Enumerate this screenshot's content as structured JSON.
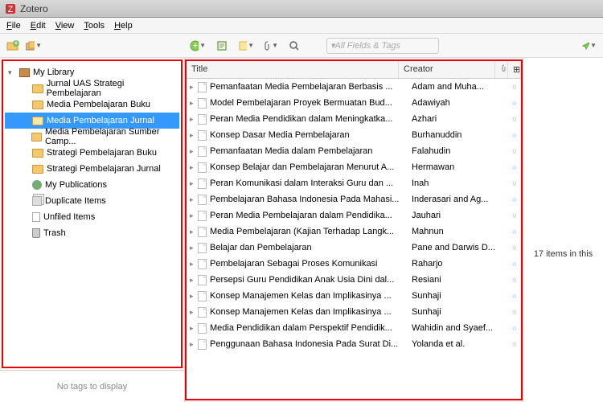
{
  "app": {
    "title": "Zotero"
  },
  "menu": {
    "file": "File",
    "edit": "Edit",
    "view": "View",
    "tools": "Tools",
    "help": "Help"
  },
  "search": {
    "placeholder": "All Fields & Tags"
  },
  "library": {
    "root": "My Library",
    "folders": [
      {
        "label": "Jurnal UAS Strategi Pembelajaran"
      },
      {
        "label": "Media Pembelajaran Buku"
      },
      {
        "label": "Media Pembelajaran Jurnal",
        "selected": true
      },
      {
        "label": "Media Pembelajaran Sumber Camp..."
      },
      {
        "label": "Strategi Pembelajaran Buku"
      },
      {
        "label": "Strategi Pembelajaran Jurnal"
      }
    ],
    "mypubs": "My Publications",
    "dup": "Duplicate Items",
    "unfiled": "Unfiled Items",
    "trash": "Trash"
  },
  "tags_empty": "No tags to display",
  "columns": {
    "title": "Title",
    "creator": "Creator"
  },
  "items": [
    {
      "title": "Pemanfaatan Media Pembelajaran Berbasis ...",
      "creator": "Adam and Muha..."
    },
    {
      "title": "Model Pembelajaran Proyek Bermuatan Bud...",
      "creator": "Adawiyah"
    },
    {
      "title": "Peran Media Pendidikan dalam Meningkatka...",
      "creator": "Azhari"
    },
    {
      "title": "Konsep Dasar Media Pembelajaran",
      "creator": "Burhanuddin"
    },
    {
      "title": "Pemanfaatan Media dalam Pembelajaran",
      "creator": "Falahudin"
    },
    {
      "title": "Konsep Belajar dan Pembelajaran Menurut A...",
      "creator": "Hermawan"
    },
    {
      "title": "Peran Komunikasi dalam Interaksi Guru dan ...",
      "creator": "Inah"
    },
    {
      "title": "Pembelajaran Bahasa Indonesia Pada Mahasi...",
      "creator": "Inderasari and Ag..."
    },
    {
      "title": "Peran Media Pembelajaran dalam Pendidika...",
      "creator": "Jauhari"
    },
    {
      "title": "Media Pembelajaran (Kajian Terhadap Langk...",
      "creator": "Mahnun"
    },
    {
      "title": "Belajar dan Pembelajaran",
      "creator": "Pane and Darwis D..."
    },
    {
      "title": "Pembelajaran Sebagai Proses Komunikasi",
      "creator": "Raharjo"
    },
    {
      "title": "Persepsi Guru Pendidikan Anak Usia Dini dal...",
      "creator": "Resiani"
    },
    {
      "title": "Konsep Manajemen Kelas dan Implikasinya ...",
      "creator": "Sunhaji"
    },
    {
      "title": "Konsep Manajemen Kelas dan Implikasinya ...",
      "creator": "Sunhaji"
    },
    {
      "title": "Media Pendidikan dalam Perspektif Pendidik...",
      "creator": "Wahidin and Syaef..."
    },
    {
      "title": "Penggunaan Bahasa Indonesia Pada Surat Di...",
      "creator": "Yolanda et al."
    }
  ],
  "right": {
    "count_text": "17 items in this"
  }
}
